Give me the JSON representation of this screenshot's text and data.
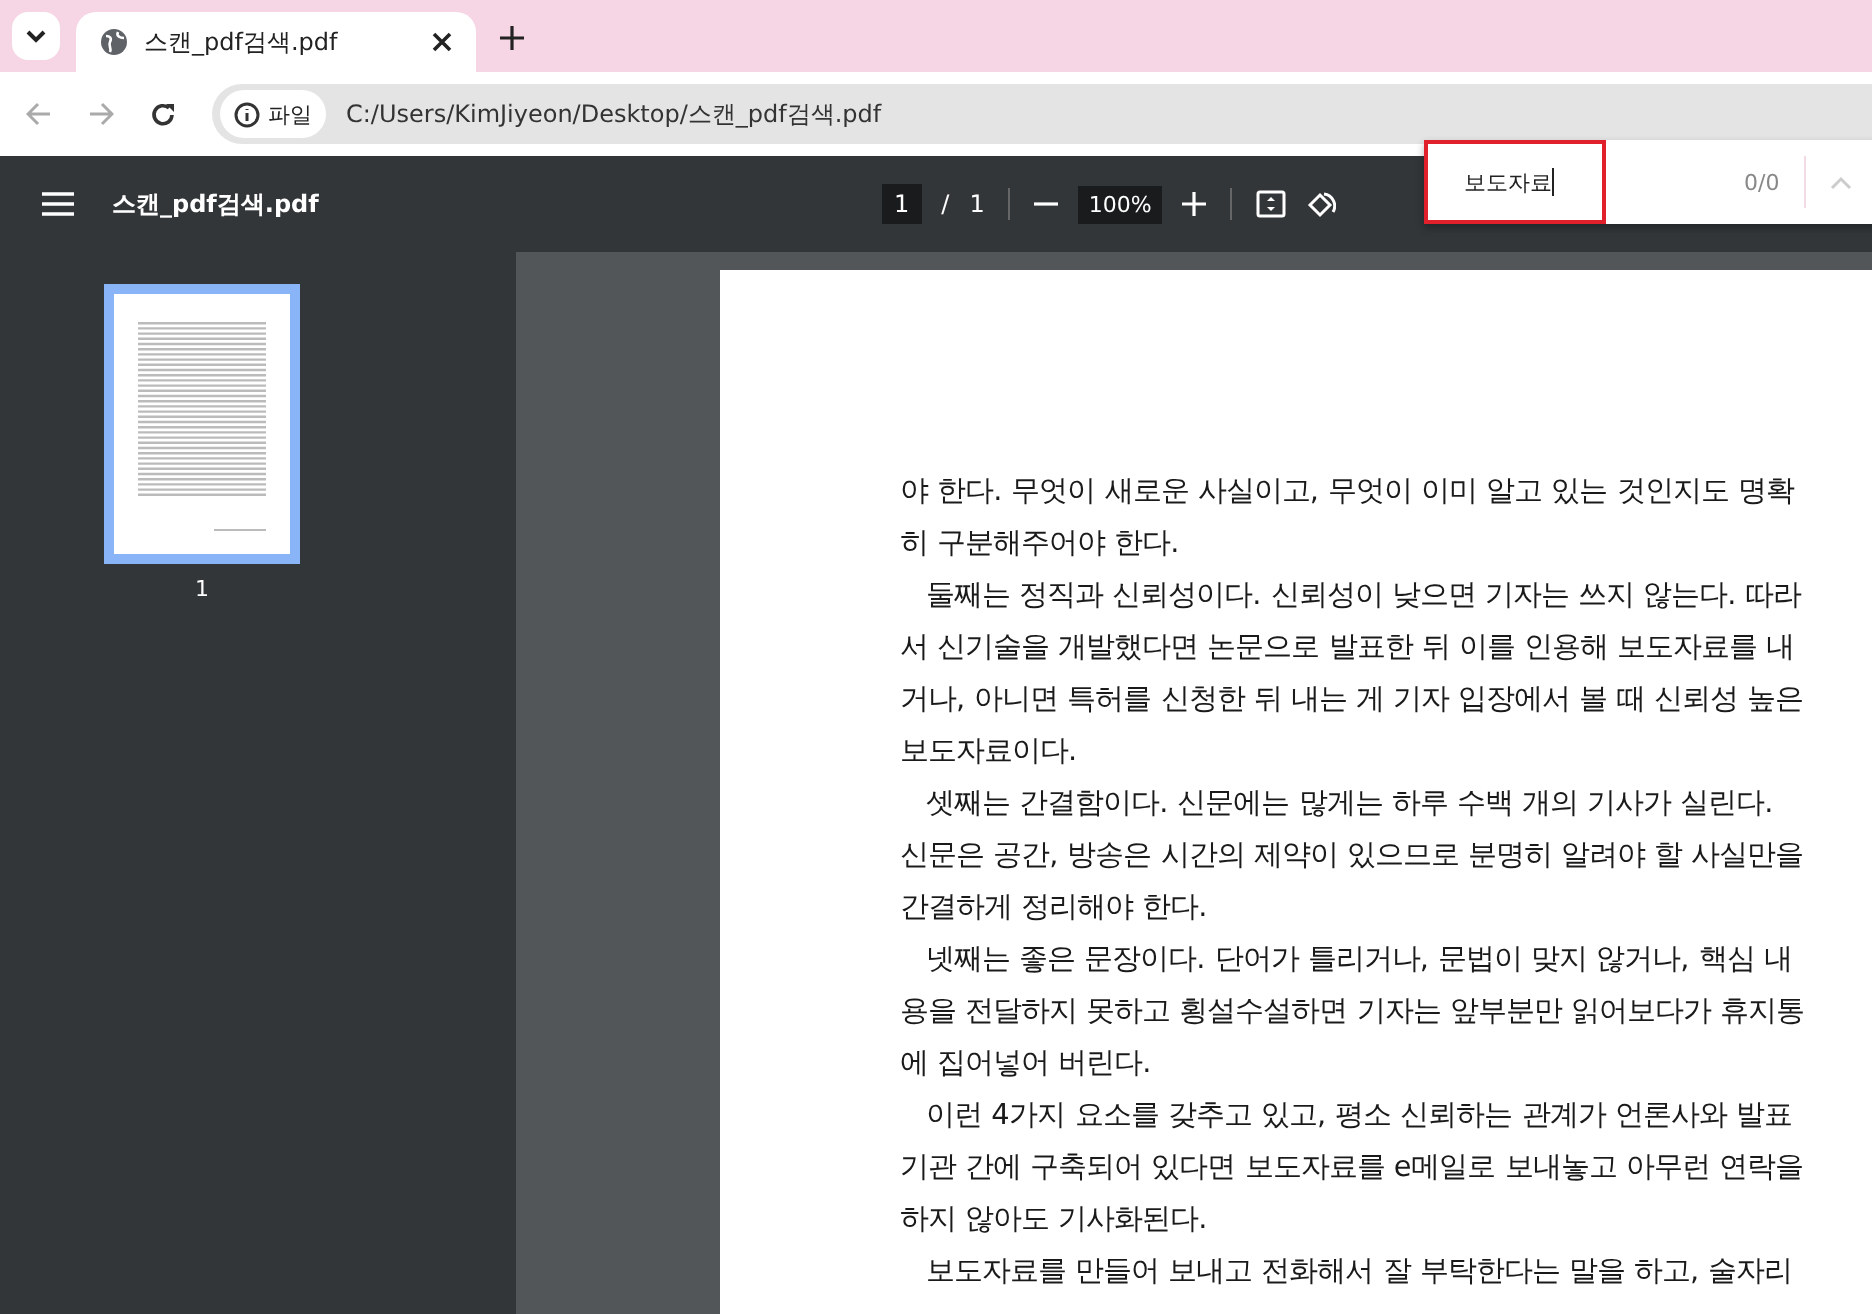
{
  "tab": {
    "title": "스캔_pdf검색.pdf",
    "selected": true
  },
  "address": {
    "chip": "파일",
    "url": "C:/Users/KimJiyeon/Desktop/스캔_pdf검색.pdf"
  },
  "toolbar": {
    "title": "스캔_pdf검색.pdf",
    "page": "1",
    "page_sep": "/",
    "page_total": "1",
    "zoom": "100%"
  },
  "find": {
    "value": "보도자료",
    "count": "0/0"
  },
  "thumbnails": [
    {
      "label": "1",
      "selected": true
    }
  ],
  "page_lines": [
    {
      "text": "야 한다. 무엇이 새로운 사실이고, 무엇이 이미 알고 있는 것인지도 명확",
      "indent": false
    },
    {
      "text": "히 구분해주어야 한다.",
      "indent": false
    },
    {
      "text": "둘째는 정직과 신뢰성이다. 신뢰성이 낮으면 기자는 쓰지 않는다. 따라",
      "indent": true
    },
    {
      "text": "서 신기술을 개발했다면 논문으로 발표한 뒤 이를 인용해 보도자료를 내",
      "indent": false
    },
    {
      "text": "거나, 아니면 특허를 신청한 뒤 내는 게 기자 입장에서 볼 때 신뢰성 높은",
      "indent": false
    },
    {
      "text": "보도자료이다.",
      "indent": false
    },
    {
      "text": "셋째는 간결함이다. 신문에는 많게는 하루 수백 개의 기사가 실린다.",
      "indent": true
    },
    {
      "text": "신문은 공간, 방송은 시간의 제약이 있으므로 분명히 알려야 할 사실만을",
      "indent": false
    },
    {
      "text": "간결하게 정리해야 한다.",
      "indent": false
    },
    {
      "text": "넷째는 좋은 문장이다. 단어가 틀리거나, 문법이 맞지 않거나, 핵심 내",
      "indent": true
    },
    {
      "text": "용을 전달하지 못하고 횡설수설하면 기자는 앞부분만 읽어보다가 휴지통",
      "indent": false
    },
    {
      "text": "에 집어넣어 버린다.",
      "indent": false
    },
    {
      "text": "이런 4가지 요소를 갖추고 있고, 평소 신뢰하는 관계가 언론사와 발표",
      "indent": true
    },
    {
      "text": "기관 간에 구축되어 있다면 보도자료를 e메일로 보내놓고 아무런 연락을",
      "indent": false
    },
    {
      "text": "하지 않아도 기사화된다.",
      "indent": false
    },
    {
      "text": "보도자료를 만들어 보내고 전화해서 잘 부탁한다는 말을 하고, 술자리",
      "indent": true
    }
  ]
}
